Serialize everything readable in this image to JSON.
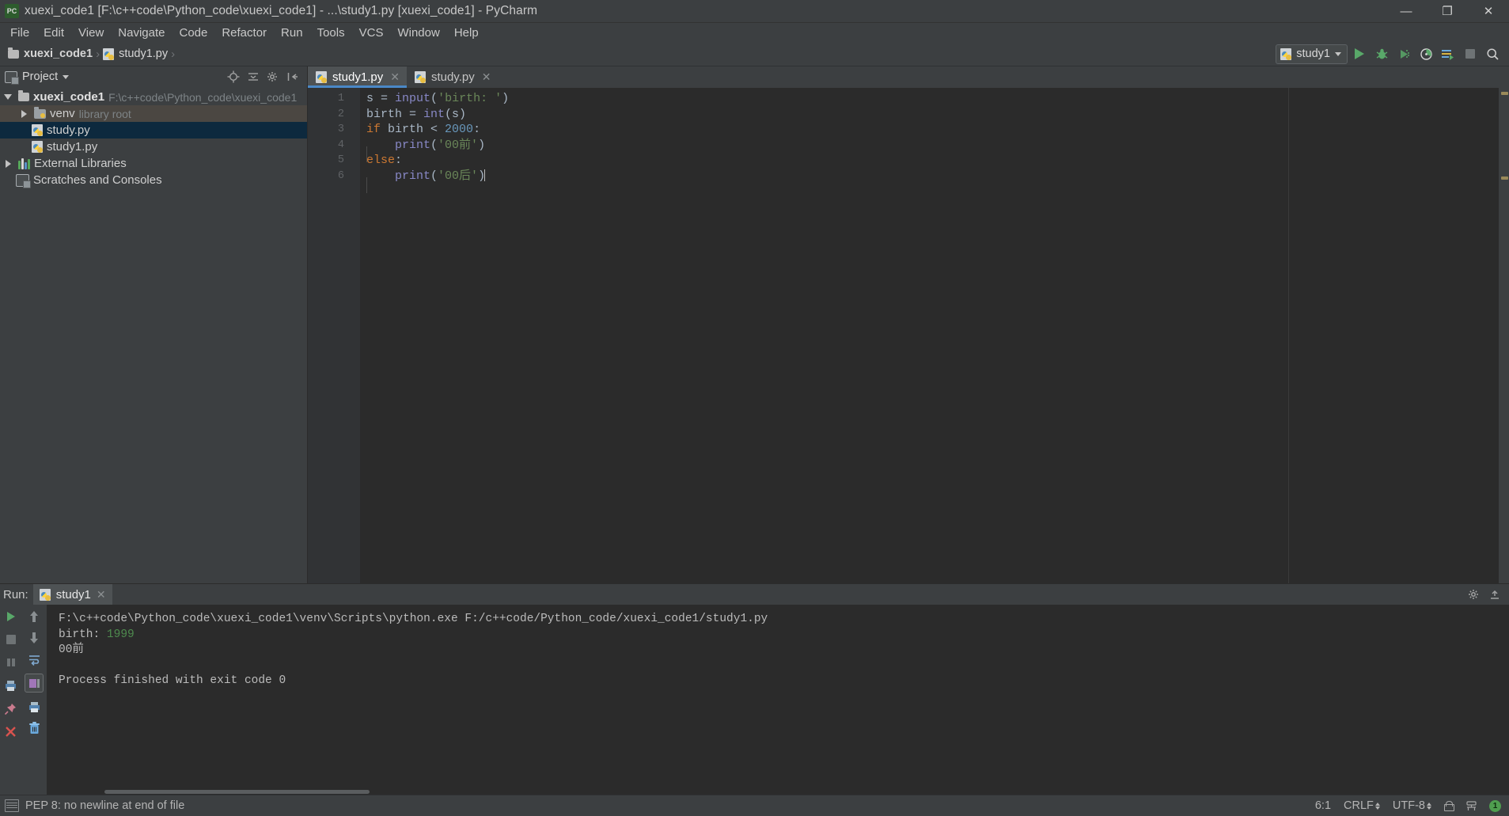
{
  "window": {
    "title": "xuexi_code1 [F:\\c++code\\Python_code\\xuexi_code1] - ...\\study1.py [xuexi_code1] - PyCharm",
    "app_icon": "pycharm-icon",
    "minimize": "—",
    "maximize": "❐",
    "close": "✕"
  },
  "menu": {
    "items": [
      {
        "label": "File"
      },
      {
        "label": "Edit"
      },
      {
        "label": "View"
      },
      {
        "label": "Navigate"
      },
      {
        "label": "Code"
      },
      {
        "label": "Refactor"
      },
      {
        "label": "Run"
      },
      {
        "label": "Tools"
      },
      {
        "label": "VCS"
      },
      {
        "label": "Window"
      },
      {
        "label": "Help"
      }
    ]
  },
  "navbar": {
    "breadcrumb": [
      {
        "label": "xuexi_code1",
        "icon": "folder-icon"
      },
      {
        "label": "study1.py",
        "icon": "python-file-icon"
      }
    ],
    "separator": "›",
    "run_config": "study1",
    "buttons": [
      {
        "name": "run-button",
        "title": "Run"
      },
      {
        "name": "debug-button",
        "title": "Debug"
      },
      {
        "name": "run-coverage-button",
        "title": "Run with Coverage"
      },
      {
        "name": "profile-button",
        "title": "Profile"
      },
      {
        "name": "run-anything-button",
        "title": "Run Anything"
      },
      {
        "name": "stop-button",
        "title": "Stop"
      },
      {
        "name": "search-everywhere-button",
        "title": "Search Everywhere"
      }
    ]
  },
  "project_panel": {
    "title": "Project",
    "header_icons": [
      "target-icon",
      "collapse-all-icon",
      "settings-icon",
      "hide-icon"
    ],
    "tree": [
      {
        "label": "xuexi_code1",
        "sub": "F:\\c++code\\Python_code\\xuexi_code1",
        "icon": "folder-icon",
        "twisty": "down",
        "depth": 0,
        "state": "normal",
        "bold": true
      },
      {
        "label": "venv",
        "sub": "library root",
        "icon": "venv-folder-icon",
        "twisty": "right",
        "depth": 1,
        "state": "hover",
        "bold": false
      },
      {
        "label": "study.py",
        "sub": "",
        "icon": "python-file-icon",
        "twisty": "none",
        "depth": 2,
        "state": "selected",
        "bold": false
      },
      {
        "label": "study1.py",
        "sub": "",
        "icon": "python-file-icon",
        "twisty": "none",
        "depth": 2,
        "state": "normal",
        "bold": false
      },
      {
        "label": "External Libraries",
        "sub": "",
        "icon": "libraries-icon",
        "twisty": "right",
        "depth": 0,
        "state": "normal",
        "bold": false
      },
      {
        "label": "Scratches and Consoles",
        "sub": "",
        "icon": "scratches-icon",
        "twisty": "none",
        "depth": 0,
        "state": "normal",
        "bold": false
      }
    ]
  },
  "editor": {
    "tabs": [
      {
        "label": "study1.py",
        "icon": "python-file-icon",
        "active": true,
        "close": "✕"
      },
      {
        "label": "study.py",
        "icon": "python-file-icon",
        "active": false,
        "close": "✕"
      }
    ],
    "line_numbers": [
      "1",
      "2",
      "3",
      "4",
      "5",
      "6"
    ],
    "lines": [
      [
        {
          "t": "s ",
          "c": "pl"
        },
        {
          "t": "= ",
          "c": "op"
        },
        {
          "t": "input",
          "c": "fn"
        },
        {
          "t": "(",
          "c": "pl"
        },
        {
          "t": "'birth: '",
          "c": "str"
        },
        {
          "t": ")",
          "c": "pl"
        }
      ],
      [
        {
          "t": "birth ",
          "c": "pl"
        },
        {
          "t": "= ",
          "c": "op"
        },
        {
          "t": "int",
          "c": "fn"
        },
        {
          "t": "(s)",
          "c": "pl"
        }
      ],
      [
        {
          "t": "if",
          "c": "k"
        },
        {
          "t": " birth ",
          "c": "pl"
        },
        {
          "t": "< ",
          "c": "op"
        },
        {
          "t": "2000",
          "c": "num"
        },
        {
          "t": ":",
          "c": "pl"
        }
      ],
      [
        {
          "t": "    ",
          "c": "pl"
        },
        {
          "t": "print",
          "c": "fn"
        },
        {
          "t": "(",
          "c": "pl"
        },
        {
          "t": "'00前'",
          "c": "str"
        },
        {
          "t": ")",
          "c": "pl"
        }
      ],
      [
        {
          "t": "else",
          "c": "k"
        },
        {
          "t": ":",
          "c": "pl"
        }
      ],
      [
        {
          "t": "    ",
          "c": "pl"
        },
        {
          "t": "print",
          "c": "fn"
        },
        {
          "t": "(",
          "c": "pl"
        },
        {
          "t": "'00后'",
          "c": "str"
        },
        {
          "t": ")",
          "c": "pl"
        }
      ]
    ]
  },
  "run_panel": {
    "label": "Run:",
    "tab": {
      "label": "study1",
      "icon": "python-file-icon",
      "close": "✕"
    },
    "header_icons": [
      "settings-gear-icon",
      "hide-icon"
    ],
    "left_toolbar": [
      "rerun-icon",
      "stop-icon",
      "pause-icon",
      "print-icon",
      "pin-icon",
      "close-icon"
    ],
    "second_toolbar": [
      "scroll-up-icon",
      "scroll-down-icon",
      "soft-wrap-icon",
      "scroll-to-end-icon",
      "print-output-icon",
      "clear-all-icon"
    ],
    "console_lines": [
      {
        "text": "F:\\c++code\\Python_code\\xuexi_code1\\venv\\Scripts\\python.exe F:/c++code/Python_code/xuexi_code1/study1.py",
        "style": "normal"
      },
      {
        "text": "birth: ",
        "style": "normal",
        "value": "1999"
      },
      {
        "text": "00前",
        "style": "normal"
      },
      {
        "text": "",
        "style": "blank"
      },
      {
        "text": "Process finished with exit code 0",
        "style": "normal"
      }
    ]
  },
  "status_bar": {
    "icon": "inspection-icon",
    "message": "PEP 8: no newline at end of file",
    "caret_position": "6:1",
    "line_separator": "CRLF",
    "encoding": "UTF-8",
    "lock_icon": "lock-icon",
    "git_icon": "git-branch-icon",
    "notification_badge": "1"
  },
  "colors": {
    "background": "#3c3f41",
    "editor_bg": "#2b2b2b",
    "selection": "#0d293e",
    "accent": "#4a88c7",
    "run_green": "#59a869",
    "keyword": "#cc7832",
    "string": "#6a8759",
    "number": "#6897bb",
    "function": "#8888c6",
    "plain": "#a9b7c6"
  }
}
